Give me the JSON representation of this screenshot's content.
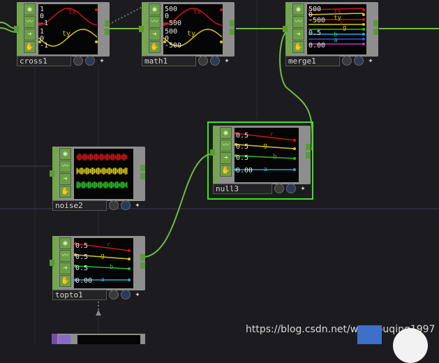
{
  "colors": {
    "background": "#1c1c20",
    "node_frame": "#8e8e8e",
    "node_green": "#6aa043",
    "wire": "#6fbd3e",
    "selected_border": "#3fe024",
    "tx": "#d01515",
    "ty": "#d8c818",
    "g": "#d8c818",
    "b": "#28c028",
    "a": "#18b0d8",
    "r": "#d01515"
  },
  "nodes": [
    {
      "id": "cross1",
      "name": "cross1",
      "labels": [
        "1",
        "0",
        "-1",
        "1",
        "0",
        "-1"
      ],
      "channels": [
        "tx",
        "ty"
      ]
    },
    {
      "id": "math1",
      "name": "math1",
      "labels": [
        "500",
        "0",
        "-500",
        "500",
        "0",
        "-500"
      ],
      "channels": [
        "tx",
        "ty"
      ]
    },
    {
      "id": "merge1",
      "name": "merge1",
      "labels": [
        "500",
        "0",
        "-500",
        "0.5",
        "0.00"
      ],
      "channels": [
        "tx",
        "ty",
        "r",
        "g",
        "b",
        "a"
      ]
    },
    {
      "id": "null3",
      "name": "null3",
      "labels": [
        "0.5",
        "0.5",
        "0.5",
        "0.00"
      ],
      "channels": [
        "r",
        "g",
        "b",
        "a"
      ]
    },
    {
      "id": "noise2",
      "name": "noise2",
      "labels": [],
      "channels": []
    },
    {
      "id": "topto1",
      "name": "topto1",
      "labels": [
        "0.5",
        "0.5",
        "0.5",
        "0.00"
      ],
      "channels": [
        "r",
        "g",
        "b",
        "a"
      ]
    }
  ],
  "icons": [
    "circle-icon",
    "curve-icon",
    "arrow-right-icon",
    "hand-icon",
    "cross-icon"
  ],
  "watermark": "https://blog.csdn.net/wangpuqing1997"
}
